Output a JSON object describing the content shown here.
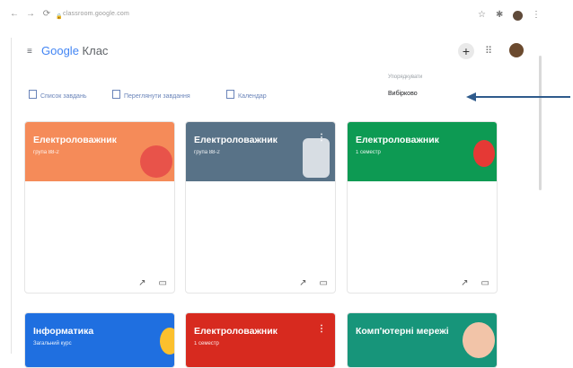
{
  "browser": {
    "url": "classroom.google.com",
    "back_icon": "←",
    "forward_icon": "→",
    "reload_icon": "⟳",
    "lock_icon": "🔒",
    "star_icon": "☆",
    "extension_icon": "✱",
    "menu_icon": "⋮"
  },
  "header": {
    "menu_icon": "≡",
    "brand_google": "Google",
    "brand_product": " Клас",
    "plus_icon": "+",
    "apps_icon": "⠿"
  },
  "subnav": {
    "todo": "Список завдань",
    "review": "Переглянути завдання",
    "calendar": "Календар"
  },
  "sort": {
    "label": "Упорядкувати",
    "value": "Вибірково"
  },
  "cards": [
    {
      "title": "Електроловажник",
      "subtitle": "група 88-2",
      "color": "#f58b59"
    },
    {
      "title": "Електроловажник",
      "subtitle": "група 88-2",
      "color": "#587287",
      "show_dots": true
    },
    {
      "title": "Електроловажник",
      "subtitle": "1 семестр",
      "color": "#0d9a53"
    },
    {
      "title": "Інформатика",
      "subtitle": "Загальний курс",
      "color": "#1f6fe0"
    },
    {
      "title": "Електроловажник",
      "subtitle": "1 семестр",
      "color": "#d72a1f",
      "show_dots": true
    },
    {
      "title": "Комп'ютерні мережі",
      "subtitle": "",
      "color": "#17957a"
    }
  ],
  "card_footer": {
    "trend_icon": "↗",
    "folder_icon": "▭"
  }
}
